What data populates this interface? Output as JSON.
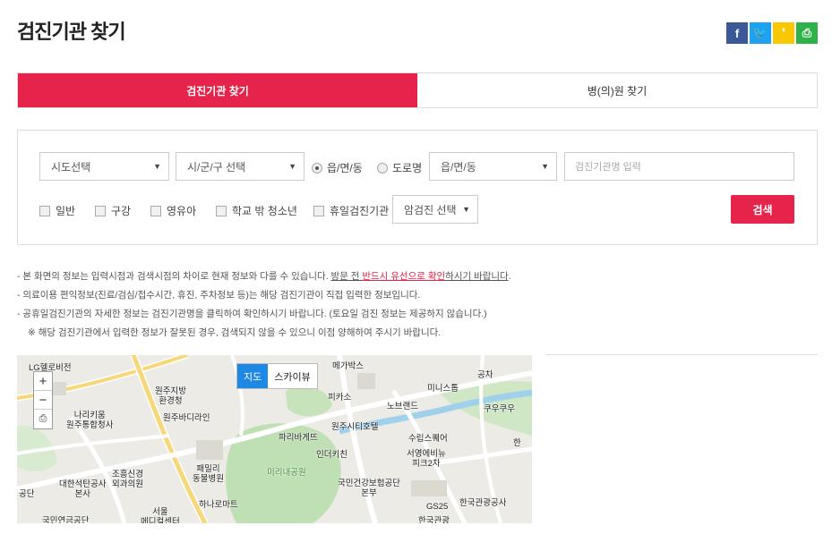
{
  "page": {
    "title": "검진기관 찾기"
  },
  "share": {
    "facebook": "f",
    "twitter": "🐦",
    "kakaostory": "❜",
    "print": "⎙"
  },
  "tabs": [
    {
      "label": "검진기관 찾기",
      "active": true
    },
    {
      "label": "병(의)원 찾기",
      "active": false
    }
  ],
  "search": {
    "sido": "시도선택",
    "sigungu": "시/군/구 선택",
    "radio_eup": "읍/면/동",
    "radio_road": "도로명",
    "eup_select": "읍/면/동",
    "name_placeholder": "검진기관명 입력",
    "checks": [
      "일반",
      "구강",
      "영유아",
      "학교 밖 청소년",
      "휴일검진기관"
    ],
    "cancer_select": "암검진 선택",
    "button": "검색"
  },
  "notes": {
    "line1_a": "- 본 화면의 정보는 입력시점과 검색시점의 차이로 현재 정보와 다를 수 있습니다.  ",
    "line1_b": "방문 전 ",
    "line1_c": "반드시 유선으로 확인",
    "line1_d": "하시기 바랍니다",
    "line1_e": ".",
    "line2": "- 의료이용 편익정보(진료/검심/접수시간, 휴진, 주차정보 등)는 해당 검진기관이 직접 입력한 정보입니다.",
    "line3": "- 공휴일검진기관의 자세한 정보는 검진기관명을 클릭하여 확인하시기 바랍니다. (토요일 검진 정보는 제공하지 않습니다.)",
    "line4": "※ 해당 검진기관에서 입력한 정보가 잘못된 경우, 검색되지 않을 수 있으니 이점 양해하여 주시기 바랍니다."
  },
  "map": {
    "type_map": "지도",
    "type_sky": "스카이뷰",
    "zoom_in": "+",
    "zoom_out": "−",
    "print": "⎙",
    "labels": [
      "LG헬로비전",
      "메가박스",
      "공차",
      "미니스톱",
      "원주지방\n환경청",
      "피카소",
      "노브랜드",
      "쿠우쿠우",
      "나리키움\n원주통합청사",
      "원주바디라인",
      "원주시티호텔",
      "파리바게뜨",
      "수립스퀘어",
      "인더키친",
      "서영에비뉴\n피크2차",
      "조흥신경\n외과의원",
      "패밀리\n동물병원",
      "미리내공원",
      "대한석탄공사\n본사",
      "국민건강보험공단\n본부",
      "하나로마트",
      "서울\n메디컬센터",
      "GS25",
      "한국관광공사",
      "한국관광",
      "국민연금공단",
      "공단",
      "한"
    ]
  }
}
